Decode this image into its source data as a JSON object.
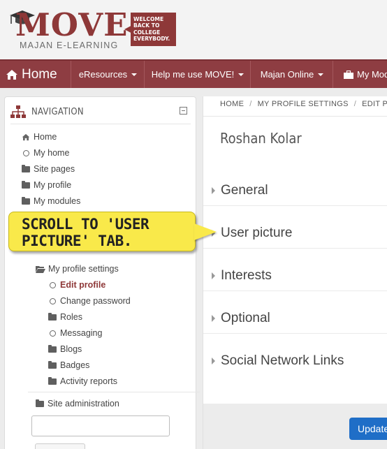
{
  "logo": {
    "title": "MOVE",
    "subtitle": "MAJAN E-LEARNING",
    "tagline": "WELCOME\nBACK TO\nCOLLEGE\nEVERYBODY."
  },
  "navbar": {
    "home": "Home",
    "items": [
      {
        "label": "eResources"
      },
      {
        "label": "Help me use MOVE!"
      },
      {
        "label": "Majan Online"
      },
      {
        "label": "My Mod"
      }
    ]
  },
  "navigation": {
    "title": "NAVIGATION",
    "top_items": [
      {
        "label": "Home",
        "icon": "home-icon"
      },
      {
        "label": "My home",
        "icon": "circle-icon"
      },
      {
        "label": "Site pages",
        "icon": "folder-icon"
      },
      {
        "label": "My profile",
        "icon": "folder-icon"
      },
      {
        "label": "My modules",
        "icon": "folder-icon"
      }
    ],
    "profile_settings": "My profile settings",
    "sub_items": [
      {
        "label": "Edit profile",
        "icon": "circle-icon"
      },
      {
        "label": "Change password",
        "icon": "circle-icon"
      },
      {
        "label": "Roles",
        "icon": "folder-icon"
      },
      {
        "label": "Messaging",
        "icon": "circle-icon"
      },
      {
        "label": "Blogs",
        "icon": "folder-icon"
      },
      {
        "label": "Badges",
        "icon": "folder-icon"
      },
      {
        "label": "Activity reports",
        "icon": "folder-icon"
      }
    ],
    "site_admin": "Site administration",
    "search_value": ""
  },
  "breadcrumb": {
    "items": [
      "HOME",
      "MY PROFILE SETTINGS",
      "EDIT PROF"
    ],
    "separator": "/"
  },
  "user_name": "Roshan Kolar",
  "sections": [
    "General",
    "User picture",
    "Interests",
    "Optional",
    "Social Network Links"
  ],
  "update_button": "Update",
  "callout": {
    "line1": "SCROLL TO 'USER",
    "line2": "PICTURE' TAB."
  },
  "colors": {
    "brand": "#8e3838",
    "navbar": "#8e3d42",
    "callout": "#f9e94a",
    "button": "#1f6ec7"
  }
}
